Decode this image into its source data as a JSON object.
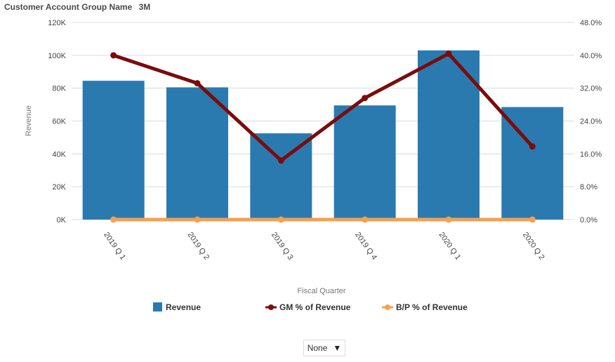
{
  "header": {
    "filter_label": "Customer Account Group Name",
    "filter_value": "3M"
  },
  "chart_data": {
    "type": "bar",
    "categories": [
      "2019 Q 1",
      "2019 Q 2",
      "2019 Q 3",
      "2019 Q 4",
      "2020 Q 1",
      "2020 Q 2"
    ],
    "xlabel": "Fiscal Quarter",
    "ylabel": "Revenue",
    "ylim": [
      0,
      120000
    ],
    "y_ticks": [
      "0K",
      "20K",
      "40K",
      "60K",
      "80K",
      "100K",
      "120K"
    ],
    "y2lim": [
      0,
      48
    ],
    "y2_ticks": [
      "0.0%",
      "8.0%",
      "16.0%",
      "24.0%",
      "32.0%",
      "40.0%",
      "48.0%"
    ],
    "grid": true,
    "legend_position": "bottom",
    "series": [
      {
        "name": "Revenue",
        "type": "bar",
        "axis": "left",
        "color": "#2a7ab0",
        "values": [
          84500,
          80500,
          52500,
          69500,
          103000,
          68500
        ]
      },
      {
        "name": "GM % of Revenue",
        "type": "line",
        "axis": "right",
        "color": "#7a0c0c",
        "values": [
          40.0,
          33.2,
          14.4,
          29.6,
          40.4,
          17.8
        ]
      },
      {
        "name": "B/P % of Revenue",
        "type": "line",
        "axis": "right",
        "color": "#f5a04e",
        "values": [
          0,
          0,
          0,
          0,
          0,
          0
        ]
      }
    ]
  },
  "controls": {
    "select_value": "None"
  }
}
